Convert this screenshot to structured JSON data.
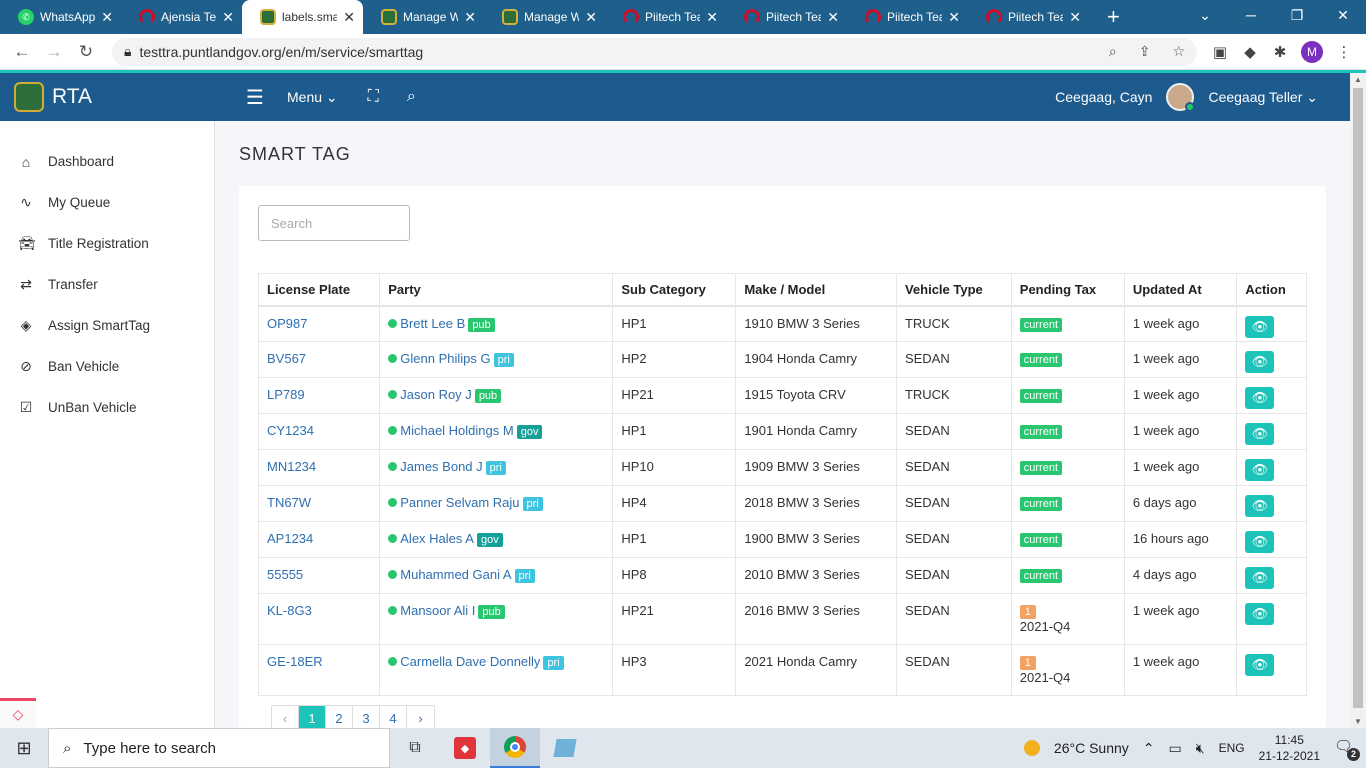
{
  "browser": {
    "tabs": [
      {
        "title": "WhatsApp",
        "icon": "whatsapp-icon",
        "active": false
      },
      {
        "title": "Ajensia Tea",
        "icon": "headphones-icon",
        "active": false
      },
      {
        "title": "labels.sma",
        "icon": "crest-icon",
        "active": true
      },
      {
        "title": "Manage W",
        "icon": "crest-icon",
        "active": false
      },
      {
        "title": "Manage W",
        "icon": "crest-icon",
        "active": false
      },
      {
        "title": "Piitech Tea",
        "icon": "headphones-icon",
        "active": false
      },
      {
        "title": "Piitech Tea",
        "icon": "headphones-icon",
        "active": false
      },
      {
        "title": "Piitech Tea",
        "icon": "headphones-icon",
        "active": false
      },
      {
        "title": "Piitech Tea",
        "icon": "headphones-icon",
        "active": false
      }
    ],
    "url": "testtra.puntlandgov.org/en/m/service/smarttag",
    "profile_initial": "M"
  },
  "header": {
    "brand": "RTA",
    "menu_label": "Menu",
    "location": "Ceegaag, Cayn",
    "user_name": "Ceegaag Teller"
  },
  "sidebar": {
    "items": [
      {
        "label": "Dashboard",
        "icon": "home-icon"
      },
      {
        "label": "My Queue",
        "icon": "trend-icon"
      },
      {
        "label": "Title Registration",
        "icon": "car-icon"
      },
      {
        "label": "Transfer",
        "icon": "exchange-icon"
      },
      {
        "label": "Assign SmartTag",
        "icon": "tags-icon"
      },
      {
        "label": "Ban Vehicle",
        "icon": "ban-icon"
      },
      {
        "label": "UnBan Vehicle",
        "icon": "check-square-icon"
      }
    ]
  },
  "page": {
    "title": "SMART TAG",
    "search_placeholder": "Search"
  },
  "table": {
    "headers": [
      "License Plate",
      "Party",
      "Sub Category",
      "Make / Model",
      "Vehicle Type",
      "Pending Tax",
      "Updated At",
      "Action"
    ],
    "rows": [
      {
        "plate": "OP987",
        "party": "Brett Lee B",
        "tag": "pub",
        "sub": "HP1",
        "model": "1910 BMW 3 Series",
        "type": "TRUCK",
        "tax": "current",
        "updated": "1 week ago"
      },
      {
        "plate": "BV567",
        "party": "Glenn Philips G",
        "tag": "pri",
        "sub": "HP2",
        "model": "1904 Honda Camry",
        "type": "SEDAN",
        "tax": "current",
        "updated": "1 week ago"
      },
      {
        "plate": "LP789",
        "party": "Jason Roy J",
        "tag": "pub",
        "sub": "HP21",
        "model": "1915 Toyota CRV",
        "type": "TRUCK",
        "tax": "current",
        "updated": "1 week ago"
      },
      {
        "plate": "CY1234",
        "party": "Michael Holdings M",
        "tag": "gov",
        "sub": "HP1",
        "model": "1901 Honda Camry",
        "type": "SEDAN",
        "tax": "current",
        "updated": "1 week ago"
      },
      {
        "plate": "MN1234",
        "party": "James Bond J",
        "tag": "pri",
        "sub": "HP10",
        "model": "1909 BMW 3 Series",
        "type": "SEDAN",
        "tax": "current",
        "updated": "1 week ago"
      },
      {
        "plate": "TN67W",
        "party": "Panner Selvam Raju",
        "tag": "pri",
        "sub": "HP4",
        "model": "2018 BMW 3 Series",
        "type": "SEDAN",
        "tax": "current",
        "updated": "6 days ago"
      },
      {
        "plate": "AP1234",
        "party": "Alex Hales A",
        "tag": "gov",
        "sub": "HP1",
        "model": "1900 BMW 3 Series",
        "type": "SEDAN",
        "tax": "current",
        "updated": "16 hours ago"
      },
      {
        "plate": "55555",
        "party": "Muhammed Gani A",
        "tag": "pri",
        "sub": "HP8",
        "model": "2010 BMW 3 Series",
        "type": "SEDAN",
        "tax": "current",
        "updated": "4 days ago"
      },
      {
        "plate": "KL-8G3",
        "party": "Mansoor Ali I",
        "tag": "pub",
        "sub": "HP21",
        "model": "2016 BMW 3 Series",
        "type": "SEDAN",
        "tax_count": "1",
        "tax_period": "2021-Q4",
        "updated": "1 week ago"
      },
      {
        "plate": "GE-18ER",
        "party": "Carmella Dave Donnelly",
        "tag": "pri",
        "sub": "HP3",
        "model": "2021 Honda Camry",
        "type": "SEDAN",
        "tax_count": "1",
        "tax_period": "2021-Q4",
        "updated": "1 week ago"
      }
    ]
  },
  "pagination": {
    "prev": "‹",
    "pages": [
      "1",
      "2",
      "3",
      "4"
    ],
    "next": "›",
    "active": "1"
  },
  "taskbar": {
    "search_placeholder": "Type here to search",
    "weather": "26°C  Sunny",
    "lang": "ENG",
    "time": "11:45",
    "date": "21-12-2021",
    "notifications": "2"
  },
  "colors": {
    "header": "#1d5a8e",
    "accent": "#1cc3b8",
    "tab_bar": "#1f5f8b"
  }
}
